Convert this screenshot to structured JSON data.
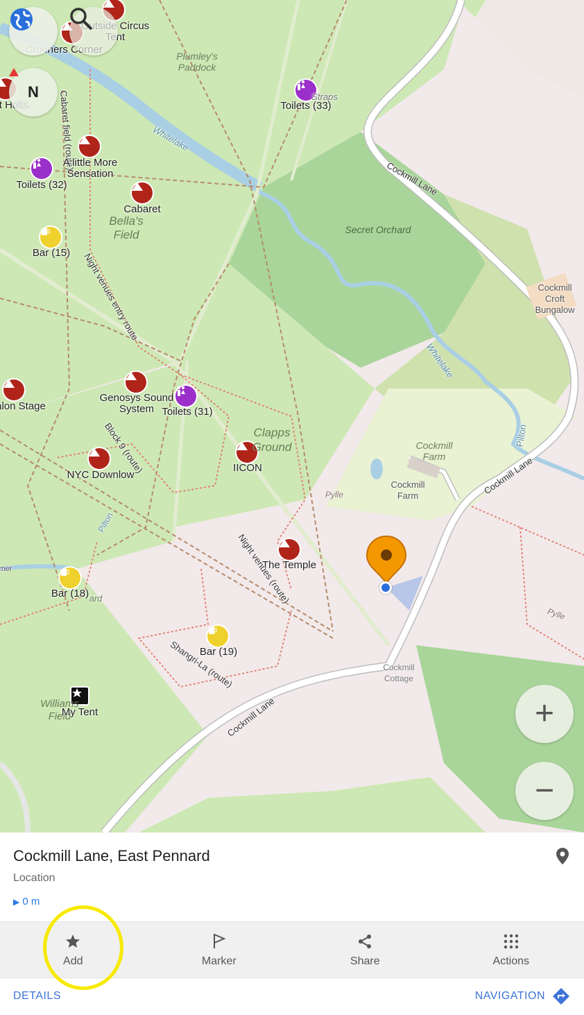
{
  "map": {
    "labels": {
      "outside_circus": "Outside Circus",
      "tent": "Tent",
      "crooners_corner": "Crooners Corner",
      "plumleys_paddock": "Plumley's\nPaddock",
      "toilets_33": "Toilets (33)",
      "straps": "Straps",
      "holts": "t Holts",
      "whitelake": "Whitelake",
      "cabaret_field_route": "Cabaret field (route)",
      "a_little_more_sensation": "A little More\nSensation",
      "toilets_32": "Toilets (32)",
      "cabaret": "Cabaret",
      "bellas_field": "Bella's\nField",
      "bar_15": "Bar (15)",
      "secret_orchard": "Secret Orchard",
      "cockmill_lane_top": "Cockmill Lane",
      "cockmill_croft_bungalow": "Cockmill\nCroft\nBungalow",
      "night_venues_entry_route": "Night venues entry route",
      "whitelake_2": "Whitelake",
      "alon_stage": "alon Stage",
      "genosys_sound_system": "Genosys Sound\nSystem",
      "toilets_31": "Toilets (31)",
      "clapps_ground": "Clapps\nGround",
      "block_9_route": "Block 9 (route)",
      "nyc_downlow": "NYC Downlow",
      "icon": "IICON",
      "cockmill_farm_italic": "Cockmill\nFarm",
      "pilton_right": "Pilton",
      "cockmill_lane_right": "Cockmill Lane",
      "cockmill_farm": "Cockmill\nFarm",
      "pylle": "Pylle",
      "pilton_left": "Pilton",
      "the_temple": "The Temple",
      "night_venues_route": "Night venues (route)",
      "mer": "mer",
      "bar_18": "Bar (18)",
      "ard": "ard",
      "pylle_right": "Pylle",
      "bar_19": "Bar (19)",
      "shangri_la_route": "Shangri-La (route)",
      "cockmill_cottage": "Cockmill\nCottage",
      "williams_field": "Williams\nField",
      "my_tent": "My Tent",
      "cockmill_lane_bottom": "Cockmill Lane"
    },
    "buttons": {
      "zoom_in": "+",
      "zoom_out": "−",
      "compass_letter": "N"
    }
  },
  "panel": {
    "title": "Cockmill Lane, East Pennard",
    "subtitle": "Location",
    "distance": "0 m"
  },
  "actions": {
    "add": "Add",
    "marker": "Marker",
    "share": "Share",
    "actions": "Actions"
  },
  "bottom": {
    "details": "DETAILS",
    "navigation": "NAVIGATION"
  },
  "colors": {
    "grass": "#cde8b4",
    "meadow": "#e9f2d3",
    "wood": "#a9d59a",
    "pink": "#f2e9ea",
    "water": "#a9cfe4",
    "accent": "#3f74d8",
    "pin": "#f39800",
    "highlight": "#f7ea00"
  }
}
